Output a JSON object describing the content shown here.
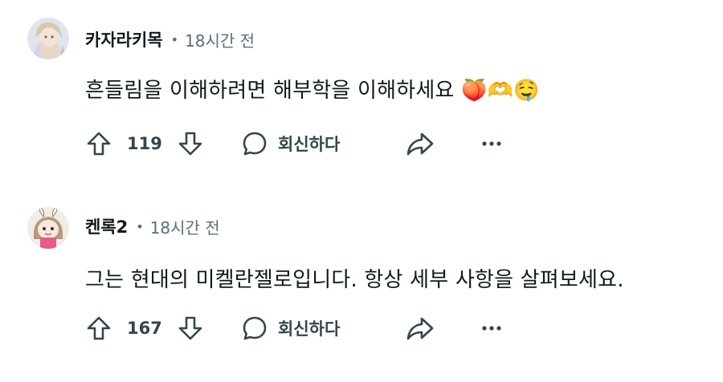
{
  "comments": [
    {
      "username": "카자라키목",
      "separator": "•",
      "time": "18시간 전",
      "text": "흔들림을 이해하려면 해부학을 이해하세요 🍑🫶🤤",
      "score": "119",
      "reply_label": "회신하다"
    },
    {
      "username": "켄록2",
      "separator": "•",
      "time": "18시간 전",
      "text": "그는 현대의 미켈란젤로입니다. 항상 세부 사항을 살펴보세요.",
      "score": "167",
      "reply_label": "회신하다"
    }
  ],
  "icons": {
    "upvote": "arrow-up-outline-icon",
    "downvote": "arrow-down-outline-icon",
    "reply": "speech-bubble-icon",
    "share": "share-arrow-icon",
    "more": "ellipsis-icon"
  },
  "colors": {
    "text_primary": "#0f1a1c",
    "text_secondary": "#576f76",
    "action_text": "#33464c"
  }
}
